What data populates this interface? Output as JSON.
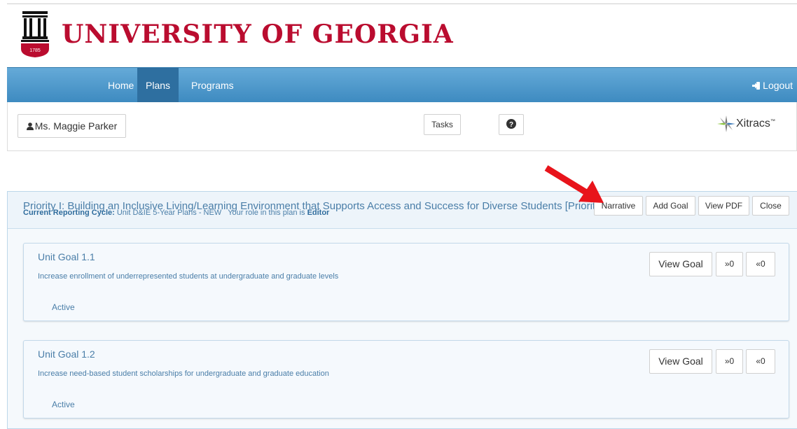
{
  "brand": {
    "title": "UNIVERSITY OF GEORGIA",
    "logo_year": "1785",
    "logo_color": "#ba0c2f"
  },
  "nav": {
    "items": [
      {
        "label": "Home",
        "active": false
      },
      {
        "label": "Plans",
        "active": true
      },
      {
        "label": "Programs",
        "active": false
      }
    ],
    "logout_label": "Logout",
    "logout_icon": "sign-out-icon"
  },
  "user_bar": {
    "user_label": "Ms. Maggie Parker",
    "user_icon": "user-icon",
    "tasks_label": "Tasks",
    "help_icon": "question-circle-icon",
    "vendor_logo": "Xitracs",
    "vendor_tm": "™"
  },
  "plan": {
    "title": "Priority I: Building an Inclusive Living/Learning Environment that Supports Access and Success for Diverse Students [Priority I]",
    "cycle_label": "Current Reporting Cycle:",
    "cycle_value": "Unit D&IE 5-Year Plans - NEW",
    "role_text": "Your role in this plan is",
    "role_value": "Editor",
    "actions": {
      "narrative": "Narrative",
      "add_goal": "Add Goal",
      "view_pdf": "View PDF",
      "close": "Close"
    }
  },
  "goals": [
    {
      "title": "Unit Goal 1.1",
      "description": "Increase enrollment of underrepresented students at undergraduate and graduate levels",
      "status": "Active",
      "view_label": "View Goal",
      "next_label": "»0",
      "prev_label": "«0"
    },
    {
      "title": "Unit Goal 1.2",
      "description": "Increase need-based student scholarships for undergraduate and graduate education",
      "status": "Active",
      "view_label": "View Goal",
      "next_label": "»0",
      "prev_label": "«0"
    }
  ],
  "colors": {
    "nav_bg": "#4d9bce",
    "nav_active": "#2e6fa0",
    "link_blue": "#4a7ea8",
    "annotation_arrow": "#e8141b"
  }
}
